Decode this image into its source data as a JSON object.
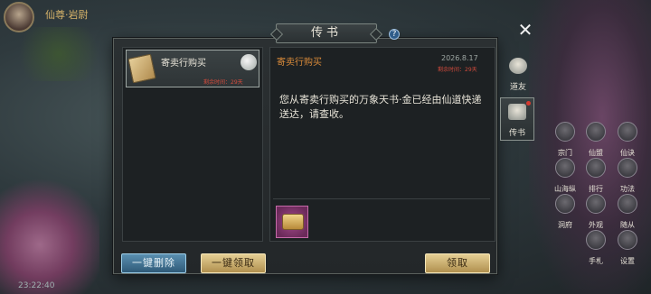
{
  "hud": {
    "player_title": "仙尊·岩尉",
    "time": "23:22:40"
  },
  "dialog": {
    "title": "传书",
    "help": "?",
    "close": "✕"
  },
  "mail_list": [
    {
      "name": "寄卖行购买",
      "remaining": "剩余时间：29天"
    }
  ],
  "detail": {
    "title": "寄卖行购买",
    "date": "2026.8.17",
    "remaining": "剩余时间：29天",
    "body": "您从寄卖行购买的万象天书·金已经由仙道快递送达，请查收。"
  },
  "buttons": {
    "delete_all": "一键删除",
    "claim_all": "一键领取",
    "claim": "领取"
  },
  "side_tabs": [
    {
      "label": "道友"
    },
    {
      "label": "传书"
    }
  ],
  "hud_icons": [
    {
      "label": "宗门"
    },
    {
      "label": "仙盟"
    },
    {
      "label": "仙诀"
    },
    {
      "label": "山海纵横"
    },
    {
      "label": "排行"
    },
    {
      "label": "功法"
    },
    {
      "label": "洞府"
    },
    {
      "label": "外观"
    },
    {
      "label": "随从"
    },
    {
      "label": "手札"
    },
    {
      "label": "设置"
    }
  ]
}
